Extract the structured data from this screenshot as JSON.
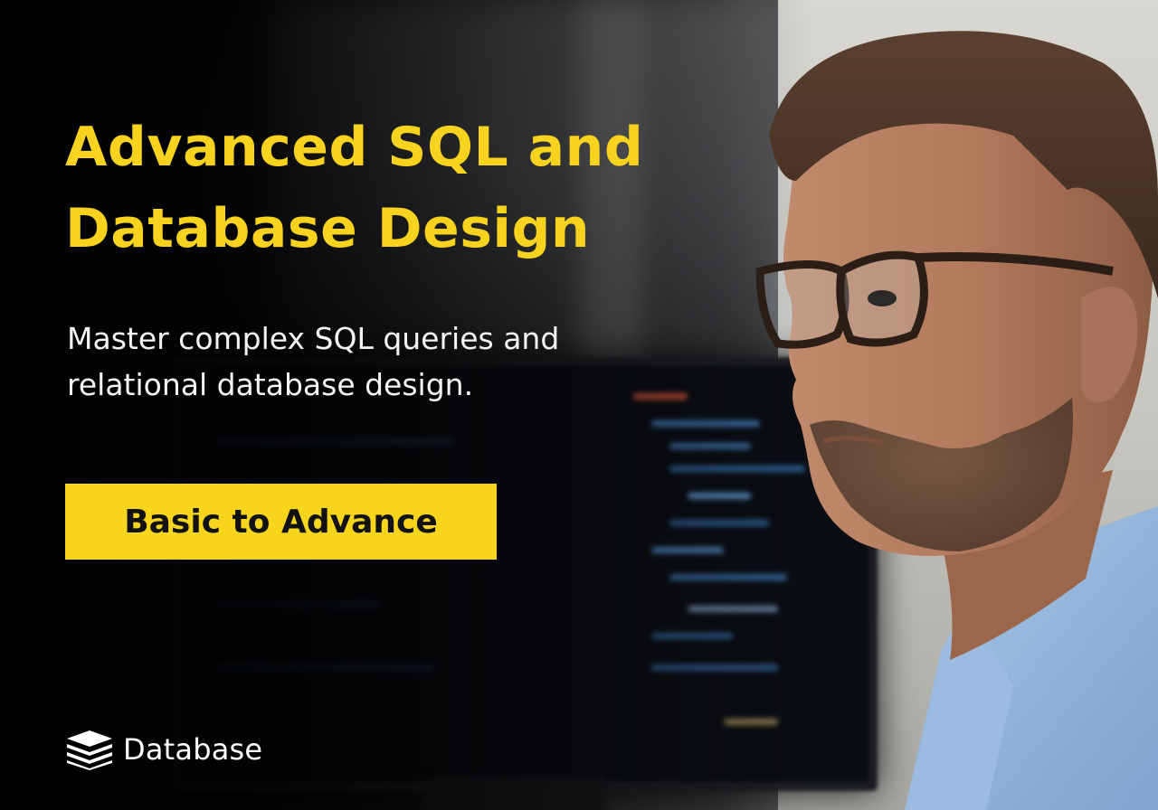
{
  "headline": {
    "line1": "Advanced SQL and",
    "line2": "Database Design"
  },
  "subheadline": {
    "line1": "Master complex SQL queries and",
    "line2": "relational database design."
  },
  "cta": {
    "label": "Basic to Advance"
  },
  "brand": {
    "name": "Database",
    "icon": "stacked-layers-icon"
  },
  "colors": {
    "accent": "#f8d51d",
    "headline_text": "#f7d21e",
    "body_text": "#f4f4f4",
    "background": "#0c0e12"
  }
}
